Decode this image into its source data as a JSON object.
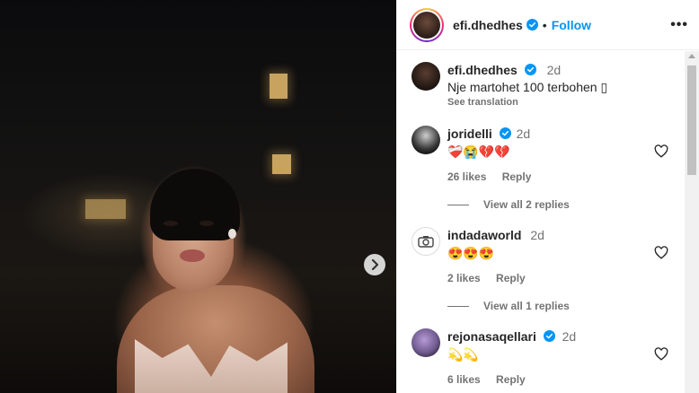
{
  "header": {
    "username": "efi.dhedhes",
    "separator": "•",
    "follow_label": "Follow",
    "more_label": "•••",
    "verified_color": "#0095f6"
  },
  "caption": {
    "username": "efi.dhedhes",
    "time": "2d",
    "text": "Nje martohet 100 terbohen ▯",
    "see_translation": "See translation"
  },
  "comments": [
    {
      "username": "joridelli",
      "verified": true,
      "time": "2d",
      "text": "❤️‍🩹😭💔💔",
      "likes": "26 likes",
      "reply": "Reply",
      "view_replies": "View all 2 replies"
    },
    {
      "username": "indadaworld",
      "verified": false,
      "time": "2d",
      "text": "😍😍😍",
      "likes": "2 likes",
      "reply": "Reply",
      "view_replies": "View all 1 replies"
    },
    {
      "username": "rejonasaqellari",
      "verified": true,
      "time": "2d",
      "text": "💫💫",
      "likes": "6 likes",
      "reply": "Reply"
    }
  ],
  "icons": {
    "next": "chevron-right-icon",
    "heart": "heart-icon",
    "verified": "verified-badge-icon",
    "more": "more-options-icon"
  }
}
